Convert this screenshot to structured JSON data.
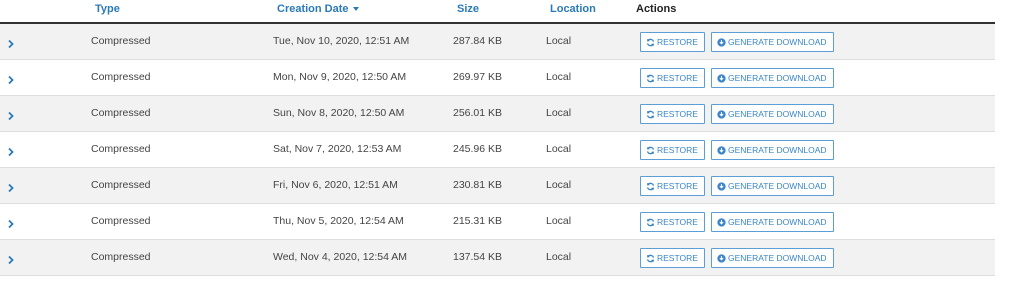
{
  "table": {
    "headers": {
      "type": "Type",
      "creation_date": "Creation Date",
      "size": "Size",
      "location": "Location",
      "actions": "Actions"
    },
    "restore_label": "RESTORE",
    "generate_label": "GENERATE DOWNLOAD",
    "rows": [
      {
        "type": "Compressed",
        "date": "Tue, Nov 10, 2020, 12:51 AM",
        "size": "287.84 KB",
        "location": "Local"
      },
      {
        "type": "Compressed",
        "date": "Mon, Nov 9, 2020, 12:50 AM",
        "size": "269.97 KB",
        "location": "Local"
      },
      {
        "type": "Compressed",
        "date": "Sun, Nov 8, 2020, 12:50 AM",
        "size": "256.01 KB",
        "location": "Local"
      },
      {
        "type": "Compressed",
        "date": "Sat, Nov 7, 2020, 12:53 AM",
        "size": "245.96 KB",
        "location": "Local"
      },
      {
        "type": "Compressed",
        "date": "Fri, Nov 6, 2020, 12:51 AM",
        "size": "230.81 KB",
        "location": "Local"
      },
      {
        "type": "Compressed",
        "date": "Thu, Nov 5, 2020, 12:54 AM",
        "size": "215.31 KB",
        "location": "Local"
      },
      {
        "type": "Compressed",
        "date": "Wed, Nov 4, 2020, 12:54 AM",
        "size": "137.54 KB",
        "location": "Local"
      }
    ]
  },
  "colors": {
    "accent": "#2a7ab8",
    "row_shade": "#f2f2f2",
    "button_border": "#5b9fd6"
  },
  "icons": {
    "expand": "chevron-right-icon",
    "restore": "refresh-icon",
    "generate": "download-circle-icon"
  }
}
